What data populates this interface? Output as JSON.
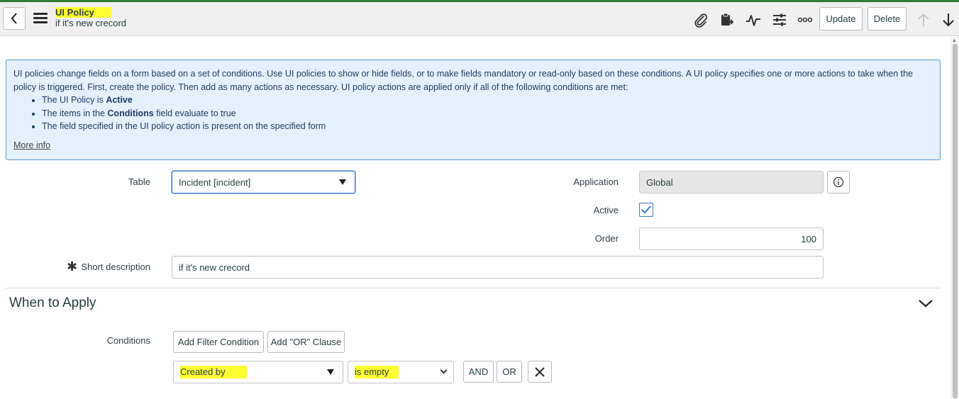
{
  "header": {
    "title": "UI Policy",
    "subtitle": "if it's new crecord",
    "update_label": "Update",
    "delete_label": "Delete",
    "icons": [
      "back-icon",
      "menu-icon",
      "paperclip-icon",
      "clipboard-icon",
      "activity-icon",
      "sliders-icon",
      "more-icon",
      "arrow-up-icon",
      "arrow-down-icon"
    ]
  },
  "info": {
    "intro": "UI policies change fields on a form based on a set of conditions. Use UI policies to show or hide fields, or to make fields mandatory or read-only based on these conditions. A UI policy specifies one or more actions to take when the policy is triggered. First, create the policy. Then add as many actions as necessary. UI policy actions are applied only if all of the following conditions are met:",
    "bullet1_pre": "The UI Policy is ",
    "bullet1_bold": "Active",
    "bullet2_pre": "The items in the ",
    "bullet2_bold": "Conditions",
    "bullet2_post": " field evaluate to true",
    "bullet3": "The field specified in the UI policy action is present on the specified form",
    "more_info": "More info"
  },
  "form": {
    "table_label": "Table",
    "table_value": "Incident [incident]",
    "application_label": "Application",
    "application_value": "Global",
    "active_label": "Active",
    "active_checked": true,
    "order_label": "Order",
    "order_value": "100",
    "short_description_label": "Short description",
    "short_description_value": "if it's new crecord",
    "required_marker": "✱"
  },
  "when_to_apply": {
    "title": "When to Apply",
    "conditions_label": "Conditions",
    "add_filter_label": "Add Filter Condition",
    "add_or_label": "Add \"OR\" Clause",
    "field_value": "Created by",
    "operator_value": "is empty",
    "and_label": "AND",
    "or_label": "OR"
  },
  "colors": {
    "highlight": "#ffff33",
    "info_bg": "#e4f0fb",
    "info_border": "#5b9bd5",
    "focus": "#3b78c8"
  }
}
